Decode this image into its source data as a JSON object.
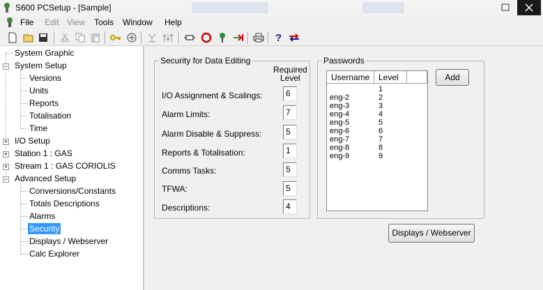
{
  "window": {
    "title": "S600 PCSetup - [Sample]"
  },
  "menu": {
    "items": [
      "File",
      "Edit",
      "View",
      "Tools",
      "Window",
      "Help"
    ]
  },
  "toolbar": {
    "buttons": [
      "new-icon",
      "open-icon",
      "save-icon",
      "cut-icon",
      "copy-icon",
      "paste-icon",
      "key-icon",
      "connect-icon",
      "network-icon",
      "sliders-icon",
      "unit-icon",
      "stop-icon",
      "tree-icon",
      "transfer-icon",
      "print-icon",
      "help-icon",
      "swap-arrows-icon"
    ]
  },
  "tree": {
    "items": [
      {
        "label": "System Graphic"
      },
      {
        "label": "System Setup",
        "expander": "−"
      },
      {
        "label": "Versions"
      },
      {
        "label": "Units"
      },
      {
        "label": "Reports"
      },
      {
        "label": "Totalisation"
      },
      {
        "label": "Time"
      },
      {
        "label": "I/O Setup",
        "expander": "+"
      },
      {
        "label": "Station 1 : GAS",
        "expander": "+"
      },
      {
        "label": "Stream 1 : GAS CORIOLIS",
        "expander": "+"
      },
      {
        "label": "Advanced Setup",
        "expander": "−"
      },
      {
        "label": "Conversions/Constants"
      },
      {
        "label": "Totals Descriptions"
      },
      {
        "label": "Alarms"
      },
      {
        "label": "Security",
        "selected": true
      },
      {
        "label": "Displays / Webserver"
      },
      {
        "label": "Calc Explorer"
      }
    ]
  },
  "security": {
    "group_title": "Security for Data Editing",
    "required_level_line1": "Required",
    "required_level_line2": "Level",
    "fields": [
      {
        "label": "I/O Assignment & Scalings:",
        "value": "6"
      },
      {
        "label": "Alarm Limits:",
        "value": "7"
      },
      {
        "label": "Alarm Disable & Suppress:",
        "value": "5"
      },
      {
        "label": "Reports & Totalisation:",
        "value": "1"
      },
      {
        "label": "Comms Tasks:",
        "value": "5"
      },
      {
        "label": "TFWA:",
        "value": "5"
      },
      {
        "label": "Descriptions:",
        "value": "4"
      }
    ]
  },
  "passwords": {
    "group_title": "Passwords",
    "columns": [
      "Username",
      "Level"
    ],
    "rows": [
      {
        "username": "",
        "level": "1"
      },
      {
        "username": "eng-2",
        "level": "2"
      },
      {
        "username": "eng-3",
        "level": "3"
      },
      {
        "username": "eng-4",
        "level": "4"
      },
      {
        "username": "eng-5",
        "level": "5"
      },
      {
        "username": "eng-6",
        "level": "6"
      },
      {
        "username": "eng-7",
        "level": "7"
      },
      {
        "username": "eng-8",
        "level": "8"
      },
      {
        "username": "eng-9",
        "level": "9"
      }
    ],
    "add_label": "Add"
  },
  "displays_button": "Displays / Webserver"
}
